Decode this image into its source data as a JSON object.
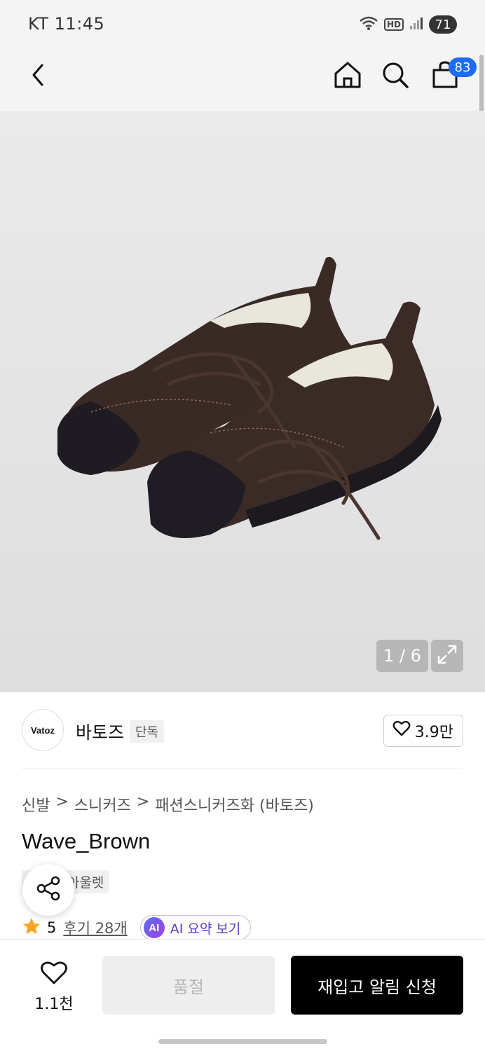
{
  "status_bar": {
    "carrier_time": "KT 11:45",
    "battery": "71",
    "hd_label": "HD"
  },
  "header": {
    "cart_badge": "83"
  },
  "gallery": {
    "counter": "1 / 6"
  },
  "brand": {
    "logo_text": "Vatoz",
    "name": "바토즈",
    "tag": "단독",
    "likes": "3.9만"
  },
  "breadcrumb": [
    "신발",
    "스니커즈",
    "패션스니커즈화 (바토즈)"
  ],
  "breadcrumb_separator": ">",
  "product": {
    "title": "Wave_Brown",
    "tags": [
      "단독",
      "아울렛"
    ],
    "rating": "5",
    "review_link": "후기 28개",
    "ai_badge": "AI",
    "ai_summary": "AI 요약 보기"
  },
  "bottom": {
    "wish_count": "1.1천",
    "soldout_label": "품절",
    "restock_label": "재입고 알림 신청"
  },
  "colors": {
    "cart_badge": "#1e6cf0",
    "rating_star": "#f5a623",
    "ai_accent": "#5b3fc4",
    "primary_button": "#000000"
  }
}
